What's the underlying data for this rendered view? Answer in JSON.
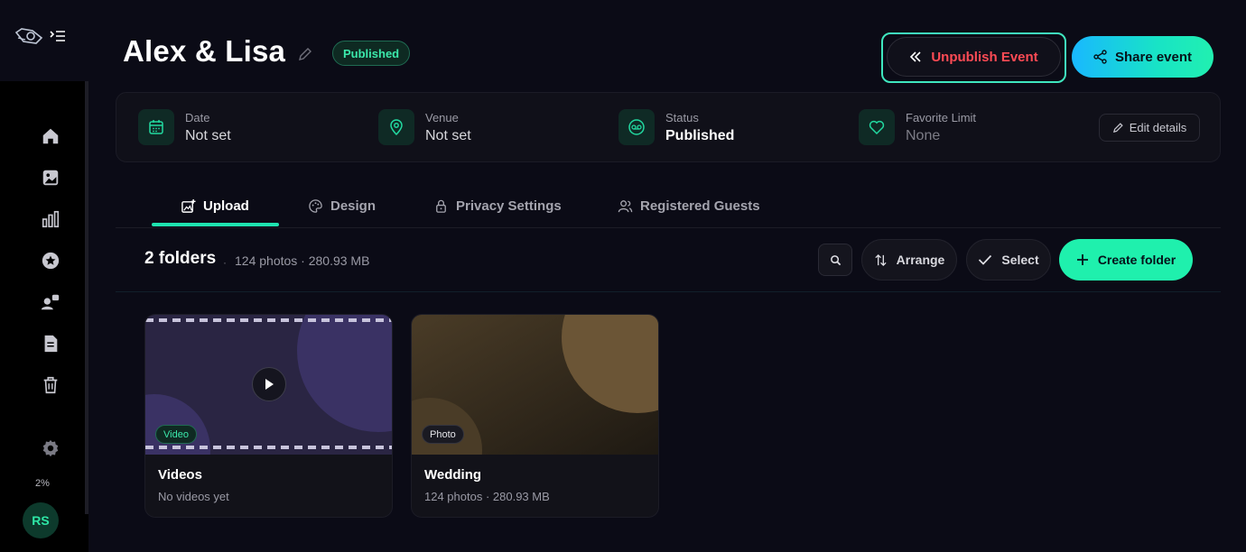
{
  "sidebar": {
    "storage_percent": "2%",
    "avatar_initials": "RS",
    "nav": [
      "home-icon",
      "gallery-icon",
      "stats-icon",
      "star-icon",
      "guests-icon",
      "document-icon",
      "trash-icon",
      "settings-icon"
    ]
  },
  "header": {
    "title": "Alex & Lisa",
    "status_badge": "Published",
    "unpublish_label": "Unpublish Event",
    "share_label": "Share event"
  },
  "info": {
    "date_label": "Date",
    "date_value": "Not set",
    "venue_label": "Venue",
    "venue_value": "Not set",
    "status_label": "Status",
    "status_value": "Published",
    "favorite_label": "Favorite Limit",
    "favorite_value": "None",
    "edit_label": "Edit details"
  },
  "tabs": [
    {
      "label": "Upload",
      "active": true
    },
    {
      "label": "Design",
      "active": false
    },
    {
      "label": "Privacy Settings",
      "active": false
    },
    {
      "label": "Registered Guests",
      "active": false
    }
  ],
  "toolbar": {
    "folders_count": "2 folders",
    "separator": "·",
    "folders_meta": "124 photos · 280.93 MB",
    "arrange_label": "Arrange",
    "select_label": "Select",
    "create_label": "Create folder"
  },
  "folders": [
    {
      "name": "Videos",
      "subtitle": "No videos yet",
      "badge": "Video"
    },
    {
      "name": "Wedding",
      "subtitle": "124 photos · 280.93 MB",
      "badge": "Photo"
    }
  ],
  "colors": {
    "accent": "#1ff0ad",
    "danger": "#ff4b55",
    "background": "#0b0b16"
  }
}
